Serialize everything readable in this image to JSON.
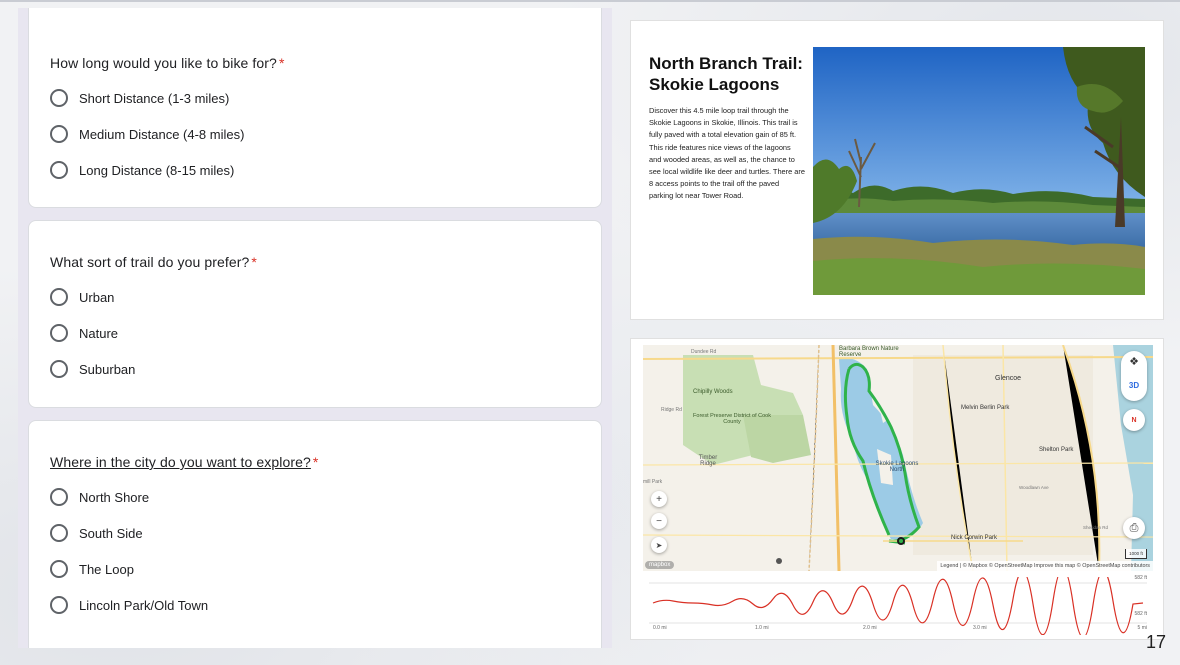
{
  "form": {
    "questions": [
      {
        "title": "How long would you like to bike for?",
        "required_mark": "*",
        "options": [
          "Short Distance (1-3 miles)",
          "Medium Distance (4-8 miles)",
          "Long Distance (8-15 miles)"
        ]
      },
      {
        "title": "What sort of trail do you prefer?",
        "required_mark": "*",
        "options": [
          "Urban",
          "Nature",
          "Suburban"
        ]
      },
      {
        "title": "Where in the city do you want to explore?",
        "required_mark": "*",
        "options": [
          "North Shore",
          "South Side",
          "The Loop",
          "Lincoln Park/Old Town"
        ]
      }
    ]
  },
  "slide": {
    "title_line1": "North Branch Trail:",
    "title_line2": "Skokie Lagoons",
    "description": "Discover this 4.5 mile loop trail through the Skokie Lagoons in Skokie, Illinois. This trail is fully paved with a total elevation gain of 85 ft. This ride features nice views of the lagoons and wooded areas, as well as, the chance to see local wildlife like deer and turtles. There are 8 access points to the trail off the paved parking lot near Tower Road."
  },
  "map": {
    "labels": {
      "barbara_brown": "Barbara Brown Nature Reserve",
      "glencoe": "Glencoe",
      "chipilly": "Chipilly Woods",
      "melvin_berlin": "Melvin Berlin Park",
      "forest_preserve": "Forest Preserve District of Cook County",
      "shelton": "Shelton Park",
      "timber_ridge": "Timber Ridge",
      "skokie_lagoons": "Skokie Lagoons North",
      "nick_corwin": "Nick Corwin Park",
      "dundee_rd": "Dundee Rd",
      "mill_park": "mill Park",
      "ridge_rd": "Ridge Rd",
      "woodlawn": "Woodlawn Ave",
      "sheridan": "Sheridan Rd"
    },
    "controls": {
      "layers_icon": "layers-icon",
      "mode_3d": "3D",
      "compass": "N",
      "zoom_in": "+",
      "zoom_out": "−",
      "print_icon": "print-icon"
    },
    "attribution": "Legend | © Mapbox © OpenStreetMap Improve this map © OpenStreetMap contributors",
    "scale": "1000 ft",
    "logo": "mapbox"
  },
  "elevation": {
    "max_label": "582 ft",
    "min_label": "582 ft",
    "x_labels": [
      "0.0 mi",
      "1.0 mi",
      "2.0 mi",
      "3.0 mi",
      "5 mi"
    ],
    "line_color": "#d93025"
  },
  "page_number": "17"
}
